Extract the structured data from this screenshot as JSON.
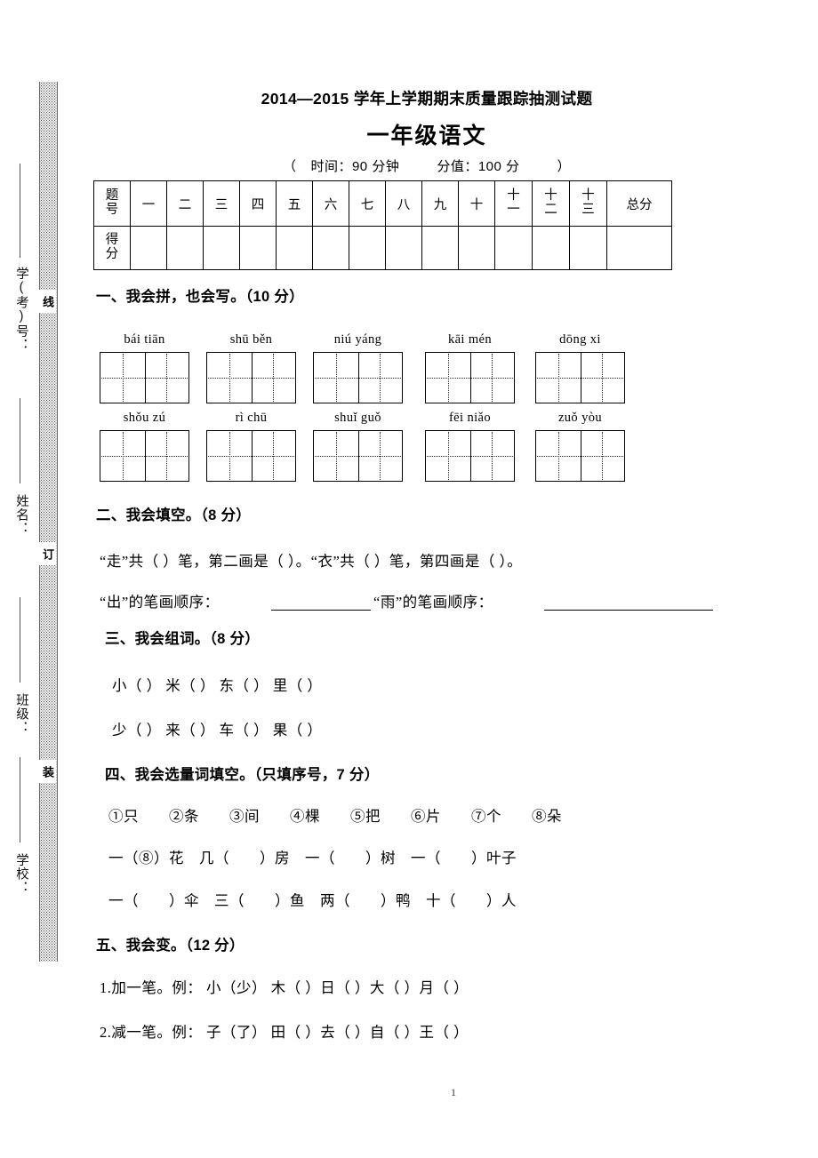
{
  "header": {
    "title": "2014—2015 学年上学期期末质量跟踪抽测试题",
    "subject": "一年级语文",
    "meta_open": "（",
    "meta_time_label": "时间：",
    "meta_time_value": "90 分钟",
    "meta_score_label": "分值：",
    "meta_score_value": "100 分",
    "meta_close": "）"
  },
  "left_margin": {
    "fields": [
      {
        "label": "学(考)号："
      },
      {
        "label": "姓名："
      },
      {
        "label": "班级："
      },
      {
        "label": "学校："
      }
    ],
    "seal_chars": [
      "线",
      "订",
      "装"
    ]
  },
  "score_table": {
    "row_labels": [
      "题号",
      "得分"
    ],
    "columns": [
      "一",
      "二",
      "三",
      "四",
      "五",
      "六",
      "七",
      "八",
      "九",
      "十",
      "十一",
      "十二",
      "十三"
    ],
    "total_label": "总分"
  },
  "sections": [
    {
      "heading": "一、我会拼，也会写。（10 分）",
      "pinyin_rows": [
        [
          "bái tiān",
          "shū běn",
          "niú yáng",
          "kāi mén",
          "dōng xi"
        ],
        [
          "shǒu zú",
          "rì chū",
          "shuǐ guǒ",
          "fēi niǎo",
          "zuǒ yòu"
        ]
      ]
    },
    {
      "heading": "二、我会填空。（8 分）",
      "lines": [
        "“走”共（ ）笔，第二画是（    ）。“衣”共（ ）笔，第四画是（    ）。",
        "“出”的笔画顺序：",
        "“雨”的笔画顺序："
      ]
    },
    {
      "heading": "三、我会组词。（8 分）",
      "lines": [
        "小（        ）   米（        ）   东（        ）   里（        ）",
        "少（        ）   来（        ）   车（        ）   果（        ）"
      ]
    },
    {
      "heading": "四、我会选量词填空。（只填序号，7 分）",
      "lines": [
        "①只　　②条　　③间　　④棵　　⑤把　　⑥片　　⑦个　　⑧朵",
        "一（⑧）花　几（　　）房　一（　　）树　一（　　）叶子",
        "一（　　）伞　三（　　）鱼　两（　　）鸭　十（　　）人"
      ]
    },
    {
      "heading": "五、我会变。（12 分）",
      "lines": [
        "1.加一笔。例：  小（少）  木（    ）日（    ）大（    ）月（    ）",
        "2.减一笔。例：  子（了）  田（    ）去（    ）自（    ）王（    ）"
      ]
    }
  ],
  "footer": {
    "page_number": "1"
  }
}
